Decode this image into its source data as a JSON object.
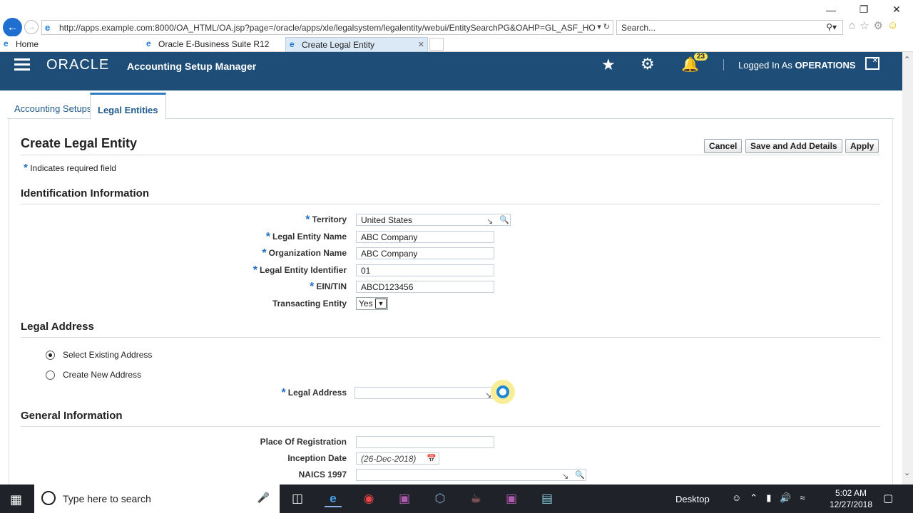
{
  "browser": {
    "window_title": "Internet Explorer",
    "address": "http://apps.example.com:8000/OA_HTML/OA.jsp?page=/oracle/apps/xle/legalsystem/legalentity/webui/EntitySearchPG&OAHP=GL_ASF_HO",
    "search_placeholder": "Search...",
    "tabs": [
      {
        "label": "Home"
      },
      {
        "label": "Oracle E-Business Suite R12"
      },
      {
        "label": "Create Legal Entity"
      }
    ]
  },
  "header": {
    "logo": "ORACLE",
    "app_title": "Accounting Setup Manager",
    "notification_count": "23",
    "logged_in_prefix": "Logged In As",
    "user": "OPERATIONS"
  },
  "page_tabs": [
    {
      "label": "Accounting Setups"
    },
    {
      "label": "Legal Entities"
    }
  ],
  "page": {
    "title": "Create Legal Entity",
    "required_note": "Indicates required field",
    "buttons": {
      "cancel": "Cancel",
      "save_add": "Save and Add Details",
      "apply": "Apply"
    }
  },
  "identification": {
    "heading": "Identification Information",
    "territory_label": "Territory",
    "territory_value": "United States",
    "le_name_label": "Legal Entity Name",
    "le_name_value": "ABC Company",
    "org_name_label": "Organization Name",
    "org_name_value": "ABC Company",
    "le_id_label": "Legal Entity Identifier",
    "le_id_value": "01",
    "ein_label": "EIN/TIN",
    "ein_value": "ABCD123456",
    "transacting_label": "Transacting Entity",
    "transacting_value": "Yes"
  },
  "legal_address": {
    "heading": "Legal Address",
    "option_existing": "Select Existing Address",
    "option_new": "Create New Address",
    "selected": "existing",
    "address_label": "Legal Address",
    "address_value": ""
  },
  "general": {
    "heading": "General Information",
    "place_label": "Place Of Registration",
    "place_value": "",
    "inception_label": "Inception Date",
    "inception_value": "(26-Dec-2018)",
    "naics_label": "NAICS 1997",
    "naics_value": ""
  },
  "taskbar": {
    "search_placeholder": "Type here to search",
    "desktop_label": "Desktop",
    "time": "5:02 AM",
    "date": "12/27/2018"
  }
}
